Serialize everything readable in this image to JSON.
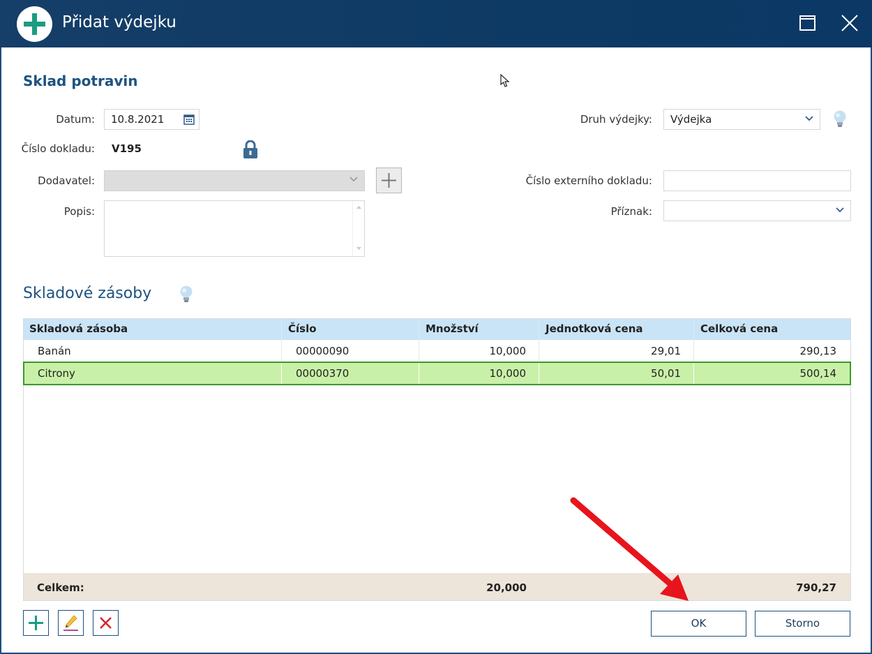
{
  "window": {
    "title": "Přidat výdejku",
    "accent": "#0d3a64"
  },
  "form": {
    "section_title": "Sklad potravin",
    "datum_label": "Datum:",
    "datum_value": "10.8.2021",
    "cislo_label": "Číslo dokladu:",
    "cislo_value": "V195",
    "dodavatel_label": "Dodavatel:",
    "dodavatel_value": "",
    "popis_label": "Popis:",
    "popis_value": "",
    "druh_label": "Druh výdejky:",
    "druh_value": "Výdejka",
    "externi_label": "Číslo externího dokladu:",
    "externi_value": "",
    "priznak_label": "Příznak:",
    "priznak_value": ""
  },
  "stock": {
    "section_title": "Skladové zásoby",
    "columns": [
      "Skladová zásoba",
      "Číslo",
      "Množství",
      "Jednotková cena",
      "Celková cena"
    ],
    "rows": [
      {
        "name": "Banán",
        "cislo": "00000090",
        "mnozstvi": "10,000",
        "jednotkova": "29,01",
        "celkova": "290,13"
      },
      {
        "name": "Citrony",
        "cislo": "00000370",
        "mnozstvi": "10,000",
        "jednotkova": "50,01",
        "celkova": "500,14"
      }
    ],
    "selected_row": 1,
    "footer": {
      "label": "Celkem:",
      "mnozstvi": "20,000",
      "celkova": "790,27"
    }
  },
  "buttons": {
    "ok": "OK",
    "storno": "Storno"
  },
  "icons": {
    "title": "add-circle-icon",
    "maximize": "maximize-icon",
    "close": "close-icon",
    "calendar": "calendar-icon",
    "lock": "lock-icon",
    "hint": "lightbulb-icon",
    "add": "plus-icon",
    "edit": "pencil-icon",
    "delete": "x-icon"
  },
  "colors": {
    "selected_row_bg": "#c9f0a8",
    "selected_row_border": "#3b9a2a",
    "header_bg": "#c9e4f6",
    "footer_bg": "#ede4da",
    "annotation_arrow": "#e8141c"
  }
}
